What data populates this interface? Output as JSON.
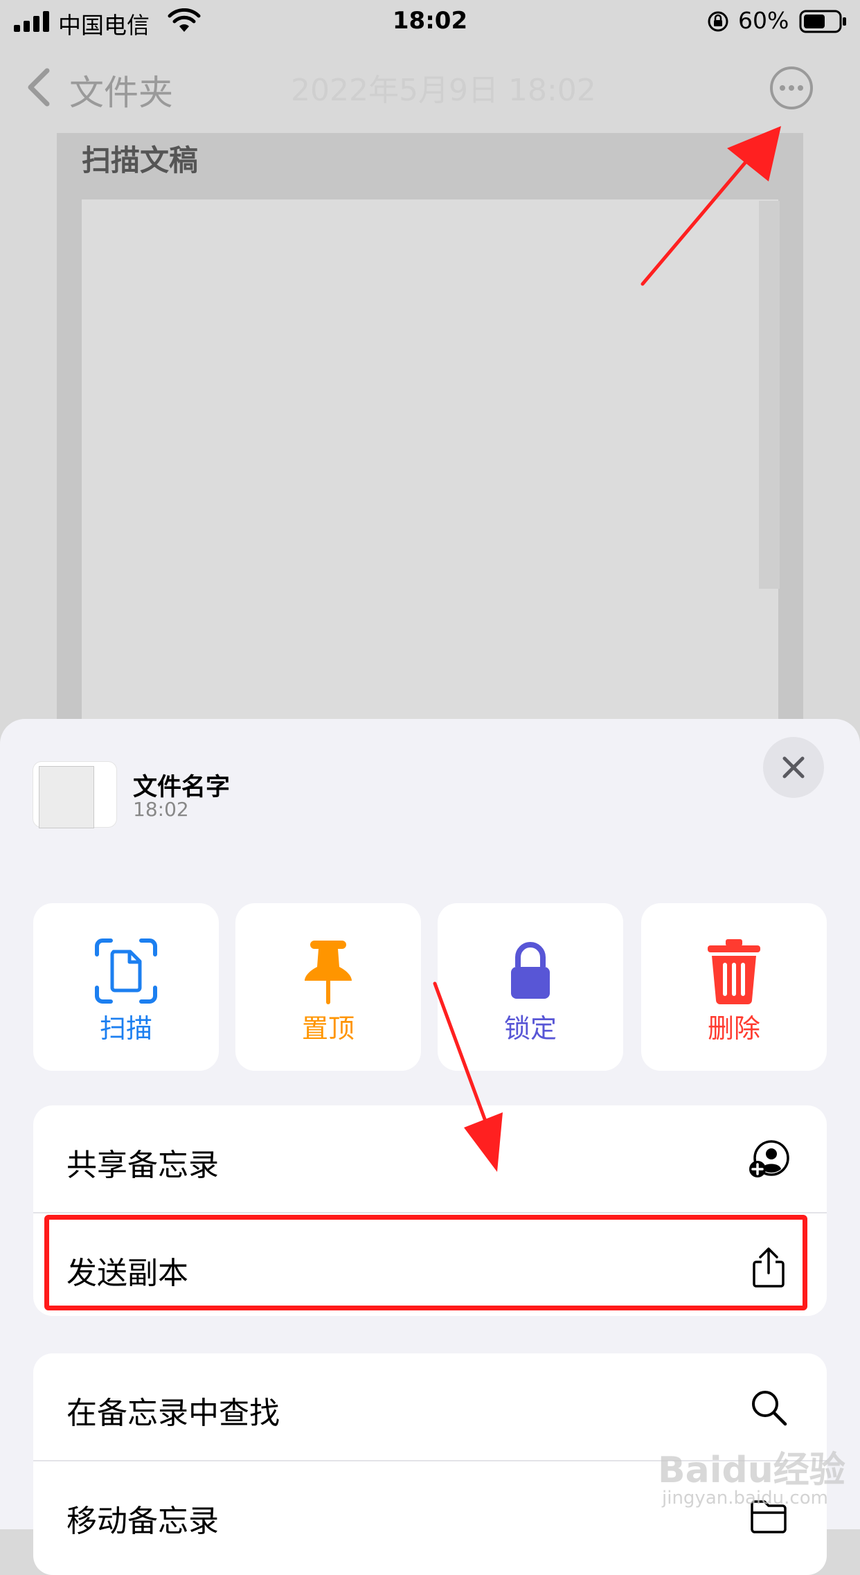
{
  "status_bar": {
    "carrier": "中国电信",
    "time": "18:02",
    "battery": "60%"
  },
  "nav": {
    "back_label": "文件夹",
    "title": "2022年5月9日 18:02"
  },
  "note": {
    "scan_title": "扫描文稿"
  },
  "sheet": {
    "file_name": "文件名字",
    "file_time": "18:02",
    "actions": [
      {
        "label": "扫描",
        "icon": "scan-document-icon",
        "color": "#1c7ff0"
      },
      {
        "label": "置顶",
        "icon": "pin-icon",
        "color": "#ff9500"
      },
      {
        "label": "锁定",
        "icon": "lock-icon",
        "color": "#5856d6"
      },
      {
        "label": "删除",
        "icon": "trash-icon",
        "color": "#ff3b30"
      }
    ],
    "menu_group_1": [
      {
        "label": "共享备忘录",
        "icon": "add-person-icon"
      },
      {
        "label": "发送副本",
        "icon": "share-icon"
      }
    ],
    "menu_group_2": [
      {
        "label": "在备忘录中查找",
        "icon": "search-icon"
      },
      {
        "label": "移动备忘录",
        "icon": "folder-icon"
      }
    ]
  },
  "watermark": {
    "brand": "Baidu经验",
    "url": "jingyan.baidu.com"
  },
  "colors": {
    "highlight": "#ff1a1a",
    "annotation_arrow": "#ff2020"
  }
}
